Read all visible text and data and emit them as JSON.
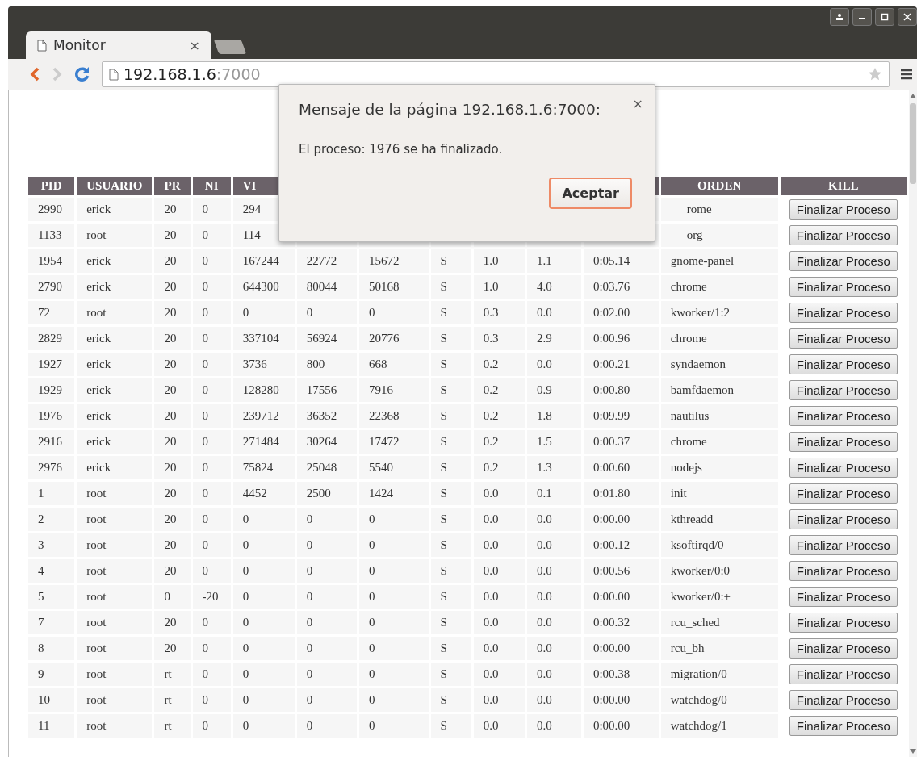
{
  "browser": {
    "tab": {
      "title": "Monitor",
      "close": "×",
      "selected": true
    },
    "address": {
      "host": "192.168.1.6",
      "port": ":7000"
    }
  },
  "table": {
    "columns": [
      "PID",
      "USUARIO",
      "PR",
      "NI",
      "VI",
      null,
      null,
      null,
      null,
      null,
      null,
      "ORDEN",
      "KILL"
    ],
    "rows": [
      {
        "cells": [
          "2990",
          "erick",
          "20",
          "0",
          "294",
          null,
          null,
          null,
          null,
          null,
          null,
          "rome"
        ],
        "button": "Finalizar Proceso"
      },
      {
        "cells": [
          "1133",
          "root",
          "20",
          "0",
          "114",
          null,
          null,
          null,
          null,
          null,
          null,
          "org"
        ],
        "button": "Finalizar Proceso"
      },
      {
        "cells": [
          "1954",
          "erick",
          "20",
          "0",
          "167244",
          "22772",
          "15672",
          "S",
          "1.0",
          "1.1",
          "0:05.14",
          "gnome-panel"
        ],
        "button": "Finalizar Proceso"
      },
      {
        "cells": [
          "2790",
          "erick",
          "20",
          "0",
          "644300",
          "80044",
          "50168",
          "S",
          "1.0",
          "4.0",
          "0:03.76",
          "chrome"
        ],
        "button": "Finalizar Proceso"
      },
      {
        "cells": [
          "72",
          "root",
          "20",
          "0",
          "0",
          "0",
          "0",
          "S",
          "0.3",
          "0.0",
          "0:02.00",
          "kworker/1:2"
        ],
        "button": "Finalizar Proceso"
      },
      {
        "cells": [
          "2829",
          "erick",
          "20",
          "0",
          "337104",
          "56924",
          "20776",
          "S",
          "0.3",
          "2.9",
          "0:00.96",
          "chrome"
        ],
        "button": "Finalizar Proceso"
      },
      {
        "cells": [
          "1927",
          "erick",
          "20",
          "0",
          "3736",
          "800",
          "668",
          "S",
          "0.2",
          "0.0",
          "0:00.21",
          "syndaemon"
        ],
        "button": "Finalizar Proceso"
      },
      {
        "cells": [
          "1929",
          "erick",
          "20",
          "0",
          "128280",
          "17556",
          "7916",
          "S",
          "0.2",
          "0.9",
          "0:00.80",
          "bamfdaemon"
        ],
        "button": "Finalizar Proceso"
      },
      {
        "cells": [
          "1976",
          "erick",
          "20",
          "0",
          "239712",
          "36352",
          "22368",
          "S",
          "0.2",
          "1.8",
          "0:09.99",
          "nautilus"
        ],
        "button": "Finalizar Proceso"
      },
      {
        "cells": [
          "2916",
          "erick",
          "20",
          "0",
          "271484",
          "30264",
          "17472",
          "S",
          "0.2",
          "1.5",
          "0:00.37",
          "chrome"
        ],
        "button": "Finalizar Proceso"
      },
      {
        "cells": [
          "2976",
          "erick",
          "20",
          "0",
          "75824",
          "25048",
          "5540",
          "S",
          "0.2",
          "1.3",
          "0:00.60",
          "nodejs"
        ],
        "button": "Finalizar Proceso"
      },
      {
        "cells": [
          "1",
          "root",
          "20",
          "0",
          "4452",
          "2500",
          "1424",
          "S",
          "0.0",
          "0.1",
          "0:01.80",
          "init"
        ],
        "button": "Finalizar Proceso"
      },
      {
        "cells": [
          "2",
          "root",
          "20",
          "0",
          "0",
          "0",
          "0",
          "S",
          "0.0",
          "0.0",
          "0:00.00",
          "kthreadd"
        ],
        "button": "Finalizar Proceso"
      },
      {
        "cells": [
          "3",
          "root",
          "20",
          "0",
          "0",
          "0",
          "0",
          "S",
          "0.0",
          "0.0",
          "0:00.12",
          "ksoftirqd/0"
        ],
        "button": "Finalizar Proceso"
      },
      {
        "cells": [
          "4",
          "root",
          "20",
          "0",
          "0",
          "0",
          "0",
          "S",
          "0.0",
          "0.0",
          "0:00.56",
          "kworker/0:0"
        ],
        "button": "Finalizar Proceso"
      },
      {
        "cells": [
          "5",
          "root",
          "0",
          "-20",
          "0",
          "0",
          "0",
          "S",
          "0.0",
          "0.0",
          "0:00.00",
          "kworker/0:+"
        ],
        "button": "Finalizar Proceso"
      },
      {
        "cells": [
          "7",
          "root",
          "20",
          "0",
          "0",
          "0",
          "0",
          "S",
          "0.0",
          "0.0",
          "0:00.32",
          "rcu_sched"
        ],
        "button": "Finalizar Proceso"
      },
      {
        "cells": [
          "8",
          "root",
          "20",
          "0",
          "0",
          "0",
          "0",
          "S",
          "0.0",
          "0.0",
          "0:00.00",
          "rcu_bh"
        ],
        "button": "Finalizar Proceso"
      },
      {
        "cells": [
          "9",
          "root",
          "rt",
          "0",
          "0",
          "0",
          "0",
          "S",
          "0.0",
          "0.0",
          "0:00.38",
          "migration/0"
        ],
        "button": "Finalizar Proceso"
      },
      {
        "cells": [
          "10",
          "root",
          "rt",
          "0",
          "0",
          "0",
          "0",
          "S",
          "0.0",
          "0.0",
          "0:00.00",
          "watchdog/0"
        ],
        "button": "Finalizar Proceso"
      },
      {
        "cells": [
          "11",
          "root",
          "rt",
          "0",
          "0",
          "0",
          "0",
          "S",
          "0.0",
          "0.0",
          "0:00.00",
          "watchdog/1"
        ],
        "button": "Finalizar Proceso"
      }
    ]
  },
  "dialog": {
    "title": "Mensaje de la página 192.168.1.6:7000:",
    "close": "×",
    "message": "El proceso: 1976 se ha finalizado.",
    "button": "Aceptar"
  }
}
